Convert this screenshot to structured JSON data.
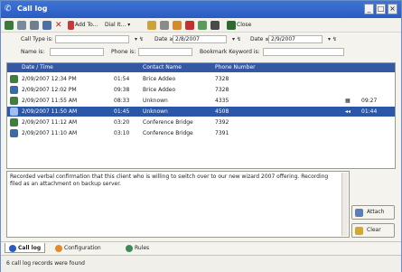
{
  "window": {
    "title": "Call log"
  },
  "toolbar": {
    "add_to_label": "Add To...",
    "dial_label": "Dial It...",
    "close_label": "Close"
  },
  "filters": {
    "call_type_label": "Call Type is:",
    "date_from_label": "Date ≥",
    "date_from_value": "2/8/2007",
    "date_to_label": "Date ≤",
    "date_to_value": "2/9/2007",
    "name_label": "Name is:",
    "phone_label": "Phone is:",
    "bookmark_label": "Bookmark Keyword is:"
  },
  "table": {
    "columns": [
      "Date / Time",
      "Contact Name",
      "Phone Number"
    ],
    "rows": [
      {
        "icon": "incoming-call-icon",
        "datetime": "2/09/2007 12:34 PM",
        "duration": "01:54",
        "name": "Brice Addeo",
        "phone": "7328",
        "extra1": "",
        "extra2": ""
      },
      {
        "icon": "outgoing-call-icon",
        "datetime": "2/09/2007 12:02 PM",
        "duration": "09:38",
        "name": "Brice Addeo",
        "phone": "7328",
        "extra1": "",
        "extra2": ""
      },
      {
        "icon": "incoming-call-icon",
        "datetime": "2/09/2007 11:55 AM",
        "duration": "08:33",
        "name": "Unknown",
        "phone": "4335",
        "extra1": "▦",
        "extra2": "09:27"
      },
      {
        "icon": "missed-call-icon",
        "datetime": "2/09/2007 11:50 AM",
        "duration": "01:45",
        "name": "Unknown",
        "phone": "4508",
        "extra1": "◂◂",
        "extra2": "01:44"
      },
      {
        "icon": "incoming-call-icon",
        "datetime": "2/09/2007 11:12 AM",
        "duration": "03:20",
        "name": "Conference Bridge",
        "phone": "7392",
        "extra1": "",
        "extra2": ""
      },
      {
        "icon": "outgoing-call-icon",
        "datetime": "2/09/2007 11:10 AM",
        "duration": "03:10",
        "name": "Conference Bridge",
        "phone": "7391",
        "extra1": "",
        "extra2": ""
      }
    ]
  },
  "notes": {
    "text": "Recorded verbal confirmation that this client who is willing to switch over to our new wizard 2007 offering. Recording filed as an attachment on backup server."
  },
  "side_buttons": {
    "attach_label": "Attach",
    "clear_label": "Clear"
  },
  "tabs": [
    {
      "label": "Call log",
      "icon": "phone-icon"
    },
    {
      "label": "Configuration",
      "icon": "gear-icon"
    },
    {
      "label": "Rules",
      "icon": "rules-icon"
    }
  ],
  "status": {
    "text": "6 call log records were found"
  },
  "colors": {
    "titlebar": "#2a5bc1",
    "selected_row": "#2a57a8",
    "header": "#3558a5"
  }
}
